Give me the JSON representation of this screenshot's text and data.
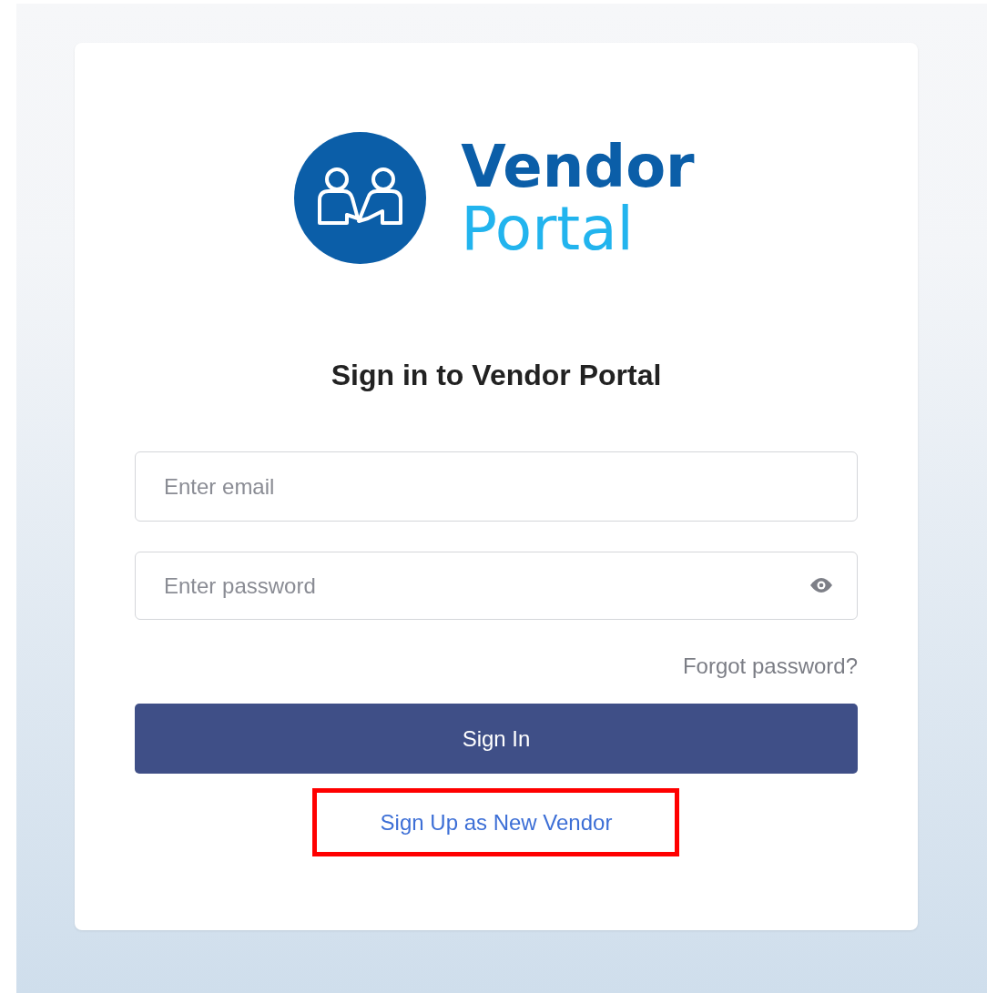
{
  "logo": {
    "line_1": "Vendor",
    "line_2": "Portal"
  },
  "heading": "Sign in to Vendor Portal",
  "email_field": {
    "placeholder": "Enter email"
  },
  "password_field": {
    "placeholder": "Enter password"
  },
  "forgot_link": "Forgot password?",
  "sign_in_button": "Sign In",
  "sign_up_link": {
    "label": "Sign Up as New Vendor",
    "highlighted": true
  }
}
